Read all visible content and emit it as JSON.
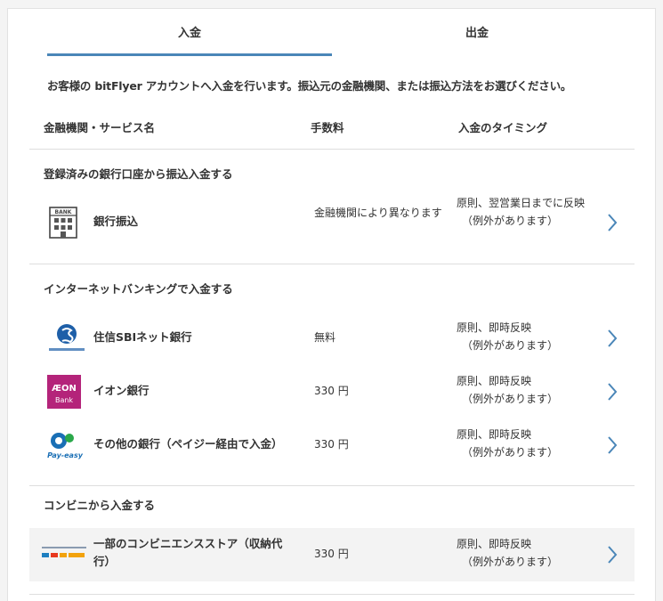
{
  "tabs": {
    "deposit": "入金",
    "withdraw": "出金"
  },
  "intro": "お客様の bitFlyer アカウントへ入金を行います。振込元の金融機関、または振込方法をお選びください。",
  "headers": {
    "name": "金融機関・サービス名",
    "fee": "手数料",
    "timing": "入金のタイミング"
  },
  "sections": {
    "registered": "登録済みの銀行口座から振込入金する",
    "netbank": "インターネットバンキングで入金する",
    "convenience": "コンビニから入金する"
  },
  "rows": {
    "bank_transfer": {
      "name": "銀行振込",
      "fee": "金融機関により異なります",
      "timing_line1": "原則、翌営業日までに反映",
      "timing_line2": "（例外があります）",
      "logo_text": "BANK"
    },
    "sbi": {
      "name": "住信SBIネット銀行",
      "fee": "無料",
      "timing_line1": "原則、即時反映",
      "timing_line2": "（例外があります）"
    },
    "aeon": {
      "name": "イオン銀行",
      "fee": "330 円",
      "timing_line1": "原則、即時反映",
      "timing_line2": "（例外があります）",
      "logo_text_top": "ÆON",
      "logo_text_bottom": "Bank"
    },
    "payeasy": {
      "name": "その他の銀行（ペイジー経由で入金）",
      "fee": "330 円",
      "timing_line1": "原則、即時反映",
      "timing_line2": "（例外があります）",
      "logo_text": "Pay-easy"
    },
    "convenience": {
      "name": "一部のコンビニエンスストア（収納代行）",
      "fee": "330 円",
      "timing_line1": "原則、即時反映",
      "timing_line2": "（例外があります）"
    }
  },
  "colors": {
    "accent": "#4a86b8",
    "chevron": "#4a86b8",
    "aeon": "#b4247a",
    "sbi": "#1e5fa8",
    "payeasy": "#1a6fb5"
  }
}
